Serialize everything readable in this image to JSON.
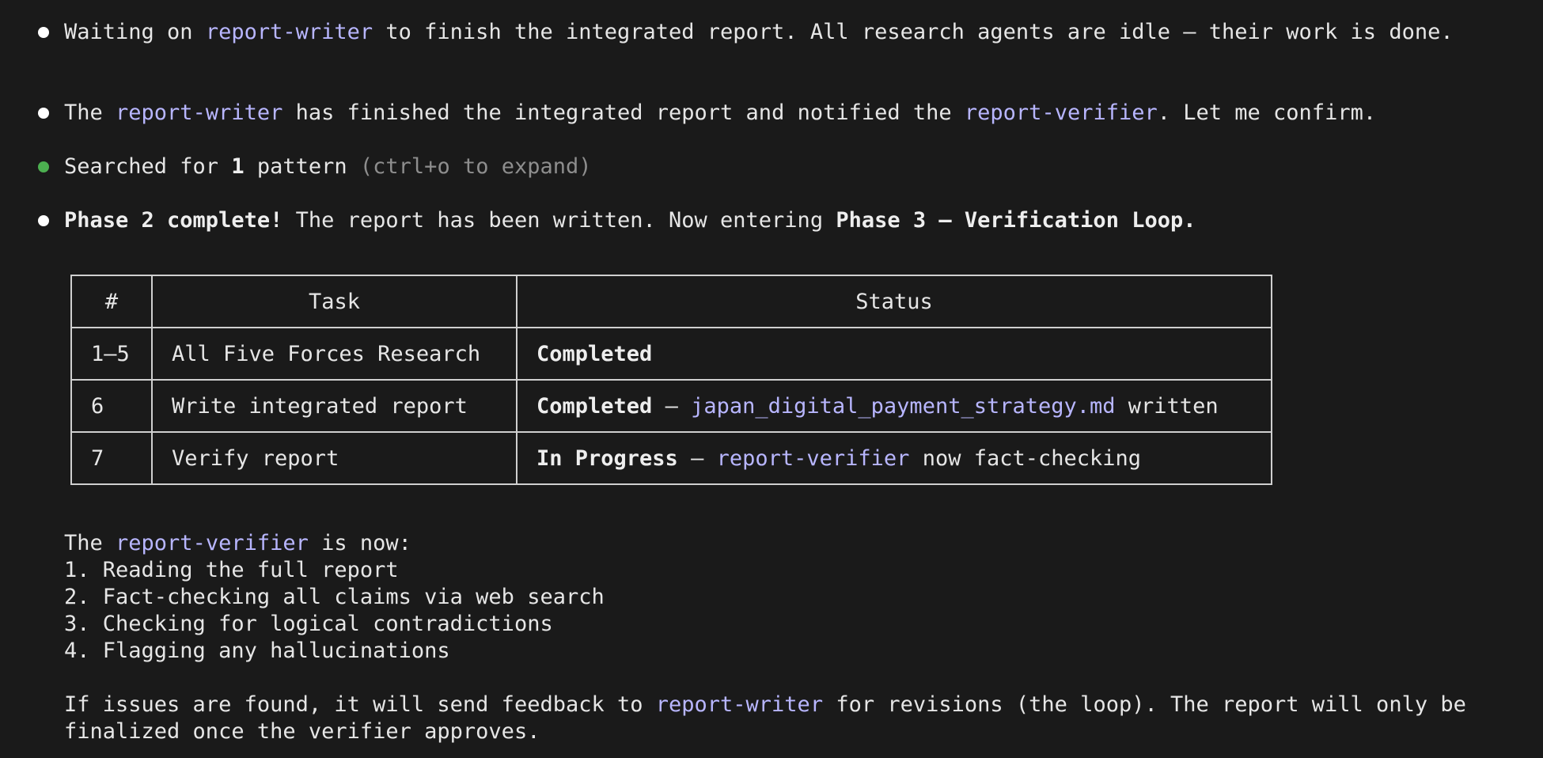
{
  "messages": {
    "m1": {
      "pre": "Waiting on ",
      "agent": "report-writer",
      "post": " to finish the integrated report. All research agents are idle — their work is done."
    },
    "m2": {
      "pre": "The ",
      "agent1": "report-writer",
      "mid": " has finished the integrated report and notified the ",
      "agent2": "report-verifier",
      "post": ". Let me confirm."
    },
    "m3": {
      "pre": "Searched for ",
      "count": "1",
      "post": " pattern ",
      "hint": "(ctrl+o to expand)"
    },
    "m4": {
      "bold1": "Phase 2 complete!",
      "mid": " The report has been written. Now entering ",
      "bold2": "Phase 3 — Verification Loop."
    }
  },
  "table": {
    "headers": [
      "#",
      "Task",
      "Status"
    ],
    "rows": [
      {
        "num": "1–5",
        "task": "All Five Forces Research",
        "status_bold": "Completed",
        "sep": "",
        "link": "",
        "tail": ""
      },
      {
        "num": "6",
        "task": "Write integrated report",
        "status_bold": "Completed",
        "sep": " — ",
        "link": "japan_digital_payment_strategy.md",
        "tail": " written"
      },
      {
        "num": "7",
        "task": "Verify report",
        "status_bold": "In Progress",
        "sep": " — ",
        "link": "report-verifier",
        "tail": " now fact-checking"
      }
    ]
  },
  "verifier": {
    "intro_pre": "The ",
    "intro_agent": "report-verifier",
    "intro_post": " is now:",
    "steps": [
      "1. Reading the full report",
      "2. Fact-checking all claims via web search",
      "3. Checking for logical contradictions",
      "4. Flagging any hallucinations"
    ]
  },
  "closing": {
    "pre": "If issues are found, it will send feedback to ",
    "agent": "report-writer",
    "post": " for revisions (the loop). The report will only be",
    "line2": "finalized once the verifier approves."
  },
  "colors": {
    "background": "#1a1a1a",
    "text": "#e6e6e6",
    "agent": "#b8b6ff",
    "bullet": "#ffffff",
    "tool_bullet": "#4caf50",
    "hint": "#8e8e8e"
  }
}
